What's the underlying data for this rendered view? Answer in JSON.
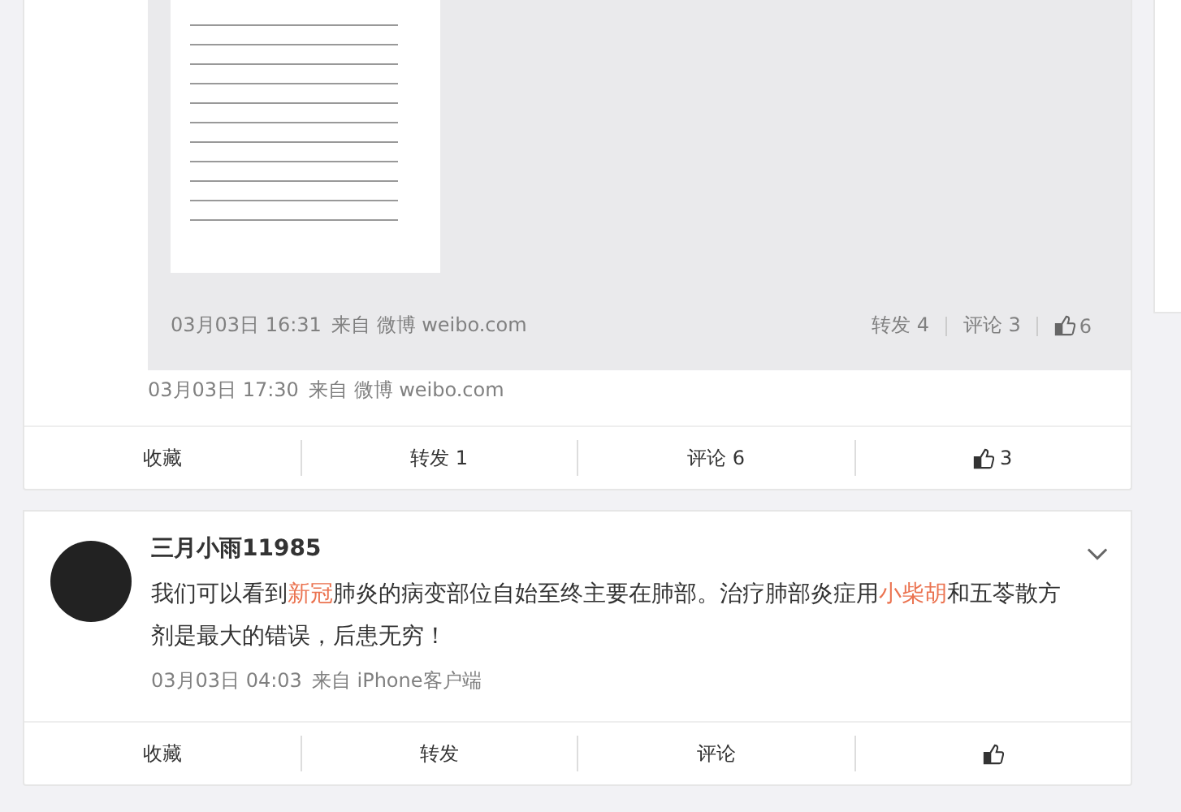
{
  "post_1": {
    "repost": {
      "time": "03月03日 16:31",
      "source": "来自 微博 weibo.com",
      "actions": [
        {
          "kind": "text",
          "label": "转发 4"
        },
        {
          "kind": "text",
          "label": "评论 3"
        },
        {
          "kind": "like",
          "label": "6"
        }
      ]
    },
    "time": "03月03日 17:30",
    "source": "来自 微博 weibo.com",
    "actions": [
      {
        "kind": "text",
        "label": "收藏"
      },
      {
        "kind": "text",
        "label": "转发 1"
      },
      {
        "kind": "text",
        "label": "评论 6"
      },
      {
        "kind": "like",
        "label": "3"
      }
    ]
  },
  "post_2": {
    "author": "三月小雨11985",
    "text": [
      {
        "kind": "plain",
        "text": "我们可以看到"
      },
      {
        "kind": "link",
        "text": "新冠"
      },
      {
        "kind": "plain",
        "text": "肺炎的病变部位自始至终主要在肺部。治疗肺部炎症用"
      },
      {
        "kind": "link",
        "text": "小柴胡"
      },
      {
        "kind": "plain",
        "text": "和五苓散方剂是最大的错误，后患无穷！"
      }
    ],
    "time": "03月03日 04:03",
    "source": "来自 iPhone客户端",
    "actions": [
      {
        "kind": "text",
        "label": "收藏"
      },
      {
        "kind": "text",
        "label": "转发"
      },
      {
        "kind": "text",
        "label": "评论"
      },
      {
        "kind": "like"
      }
    ]
  }
}
